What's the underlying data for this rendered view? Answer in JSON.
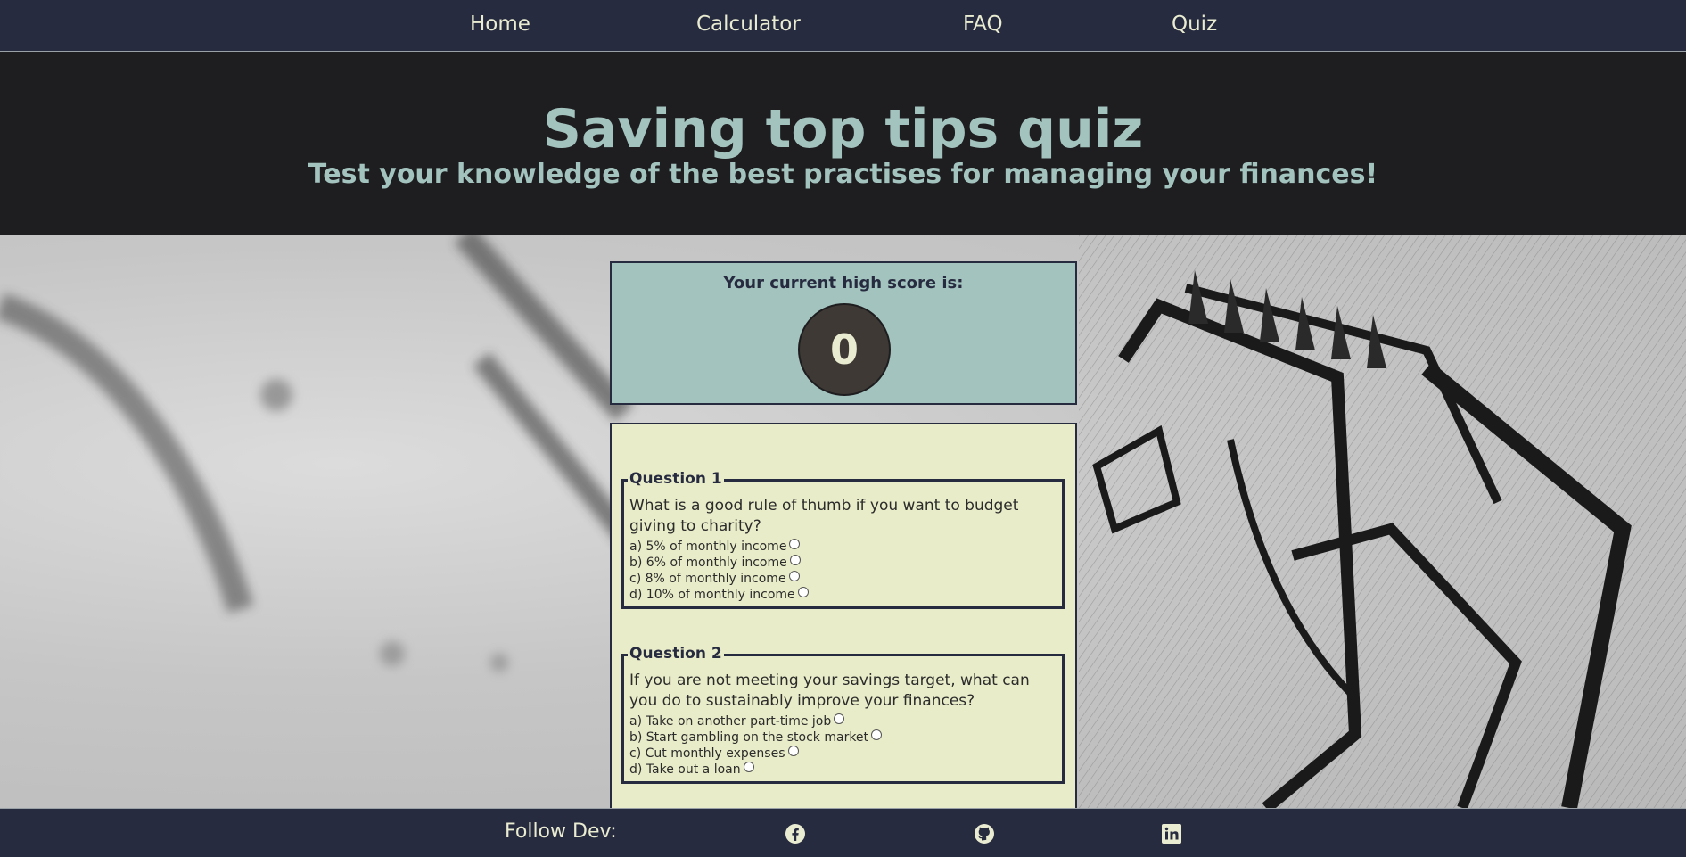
{
  "nav": {
    "items": [
      {
        "label": "Home"
      },
      {
        "label": "Calculator"
      },
      {
        "label": "FAQ"
      },
      {
        "label": "Quiz"
      }
    ]
  },
  "hero": {
    "title": "Saving top tips quiz",
    "subtitle": "Test your knowledge of the best practises for managing your finances!"
  },
  "score": {
    "label": "Your current high score is:",
    "value": "0"
  },
  "quiz": {
    "questions": [
      {
        "legend": "Question 1",
        "text": "What is a good rule of thumb if you want to budget giving to charity?",
        "options": [
          "a) 5% of monthly income",
          "b) 6% of monthly income",
          "c) 8% of monthly income",
          "d) 10% of monthly income"
        ]
      },
      {
        "legend": "Question 2",
        "text": "If you are not meeting your savings target, what can you do to sustainably improve your finances?",
        "options": [
          "a) Take on another part-time job",
          "b) Start gambling on the stock market",
          "c) Cut monthly expenses",
          "d) Take out a loan"
        ]
      }
    ]
  },
  "footer": {
    "follow_label": "Follow Dev:",
    "icons": [
      "facebook-icon",
      "github-icon",
      "linkedin-icon"
    ]
  },
  "colors": {
    "nav_bg": "#272b40",
    "hero_bg": "#1e1d1f",
    "accent": "#a3c3be",
    "quiz_bg": "#e9ecc8",
    "nav_text": "#e9ecd0"
  }
}
